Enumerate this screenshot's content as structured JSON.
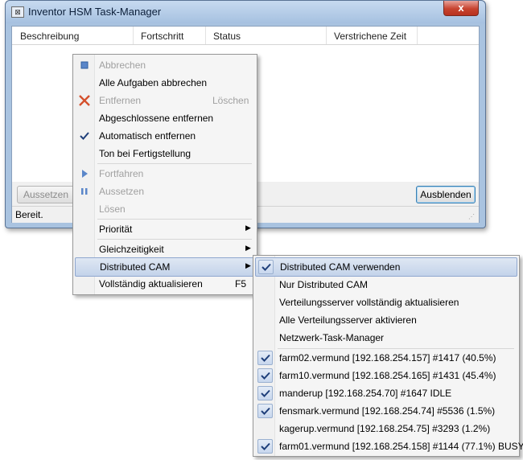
{
  "window": {
    "title": "Inventor HSM Task-Manager",
    "close_glyph": "x",
    "app_icon_glyph": "⊠"
  },
  "list": {
    "columns": [
      "Beschreibung",
      "Fortschritt",
      "Status",
      "Verstrichene Zeit"
    ]
  },
  "buttons": {
    "pause_label": "Aussetzen",
    "hide_label": "Ausblenden"
  },
  "statusbar": {
    "text": "Bereit."
  },
  "context_menu": {
    "items": [
      {
        "label": "Abbrechen",
        "enabled": false,
        "icon": "stop-icon"
      },
      {
        "label": "Alle Aufgaben abbrechen",
        "enabled": true
      },
      {
        "label": "Entfernen",
        "shortcut": "Löschen",
        "enabled": false,
        "icon": "remove-x-icon"
      },
      {
        "label": "Abgeschlossene entfernen",
        "enabled": true
      },
      {
        "label": "Automatisch entfernen",
        "enabled": true,
        "checked": true
      },
      {
        "label": "Ton bei Fertigstellung",
        "enabled": true
      },
      {
        "label": "Fortfahren",
        "enabled": false,
        "icon": "play-icon"
      },
      {
        "label": "Aussetzen",
        "enabled": false,
        "icon": "pause-icon"
      },
      {
        "label": "Lösen",
        "enabled": false
      },
      {
        "label": "Priorität",
        "enabled": true,
        "submenu": true
      },
      {
        "label": "Gleichzeitigkeit",
        "enabled": true,
        "submenu": true
      },
      {
        "label": "Distributed CAM",
        "enabled": true,
        "submenu": true,
        "highlighted": true
      },
      {
        "label": "Vollständig aktualisieren",
        "shortcut": "F5",
        "enabled": true
      }
    ]
  },
  "submenu": {
    "items": [
      {
        "label": "Distributed CAM verwenden",
        "checked": true,
        "highlighted": true
      },
      {
        "label": "Nur Distributed CAM",
        "checked": false
      },
      {
        "label": "Verteilungsserver vollständig aktualisieren",
        "checked": false
      },
      {
        "label": "Alle Verteilungsserver aktivieren",
        "checked": false
      },
      {
        "label": "Netzwerk-Task-Manager",
        "checked": false
      },
      {
        "label": "farm02.vermund [192.168.254.157] #1417 (40.5%)",
        "checked": true
      },
      {
        "label": "farm10.vermund [192.168.254.165] #1431 (45.4%)",
        "checked": true
      },
      {
        "label": "manderup [192.168.254.70] #1647 IDLE",
        "checked": true
      },
      {
        "label": "fensmark.vermund [192.168.254.74] #5536 (1.5%)",
        "checked": true
      },
      {
        "label": "kagerup.vermund [192.168.254.75] #3293 (1.2%)",
        "checked": false
      },
      {
        "label": "farm01.vermund [192.168.254.158] #1144 (77.1%) BUSY",
        "checked": true
      }
    ]
  },
  "colors": {
    "accent_highlight": "#c3d3ea",
    "check_mark": "#1f3f7a",
    "remove_icon": "#d4502c"
  }
}
